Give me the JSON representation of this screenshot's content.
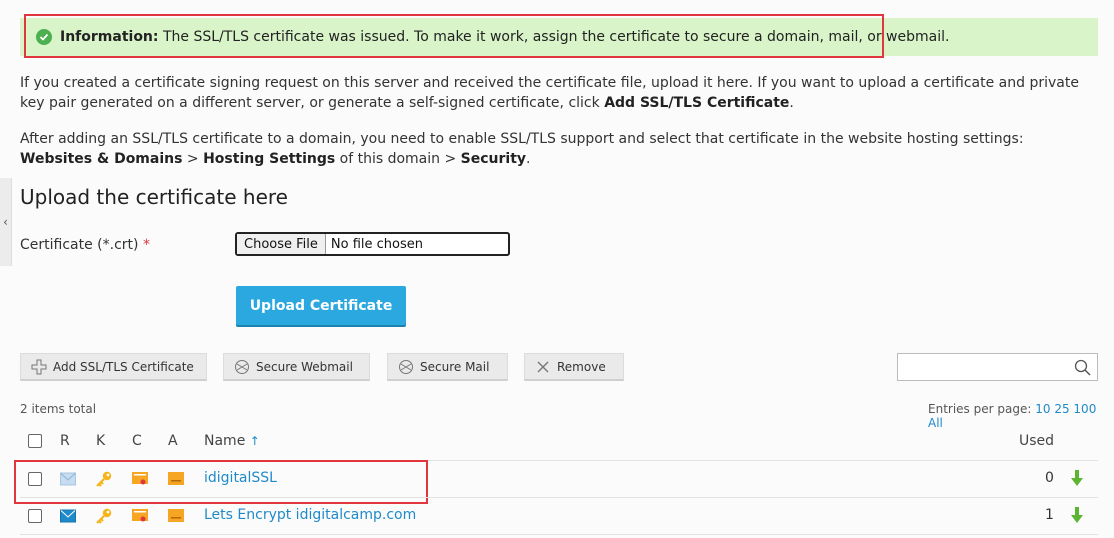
{
  "alert": {
    "label": "Information:",
    "message": "The SSL/TLS certificate was issued. To make it work, assign the certificate to secure a domain, mail, or webmail."
  },
  "intro": {
    "p1_text": "If you created a certificate signing request on this server and received the certificate file, upload it here. If you want to upload a certificate and private key pair generated on a different server, or generate a self-signed certificate, click ",
    "p1_bold": "Add SSL/TLS Certificate",
    "p1_end": ".",
    "p2_text": "After adding an SSL/TLS certificate to a domain, you need to enable SSL/TLS support and select that certificate in the website hosting settings: ",
    "p2_bold1": "Websites & Domains",
    "p2_sep": " > ",
    "p2_bold2": "Hosting Settings",
    "p2_mid": " of this domain > ",
    "p2_bold3": "Security",
    "p2_end": "."
  },
  "upload": {
    "title": "Upload the certificate here",
    "field_label": "Certificate (*.crt)",
    "required_mark": "*",
    "choose_file": "Choose File",
    "file_status": "No file chosen",
    "submit": "Upload Certificate"
  },
  "toolbar": {
    "add": "Add SSL/TLS Certificate",
    "secure_webmail": "Secure Webmail",
    "secure_mail": "Secure Mail",
    "remove": "Remove",
    "search_placeholder": ""
  },
  "list": {
    "total": "2 items total",
    "entries_label": "Entries per page:",
    "page_sizes": [
      "10",
      "25",
      "100",
      "All"
    ],
    "columns": {
      "r": "R",
      "k": "K",
      "c": "C",
      "a": "A",
      "name": "Name",
      "sort": "↑",
      "used": "Used"
    },
    "rows": [
      {
        "name": "idigitalSSL",
        "used": "0"
      },
      {
        "name": "Lets Encrypt idigitalcamp.com",
        "used": "1"
      }
    ]
  },
  "colors": {
    "accent": "#2ba8df",
    "link": "#1f8ac9",
    "success_bg": "#d8f4c8",
    "highlight": "#e0363d"
  }
}
